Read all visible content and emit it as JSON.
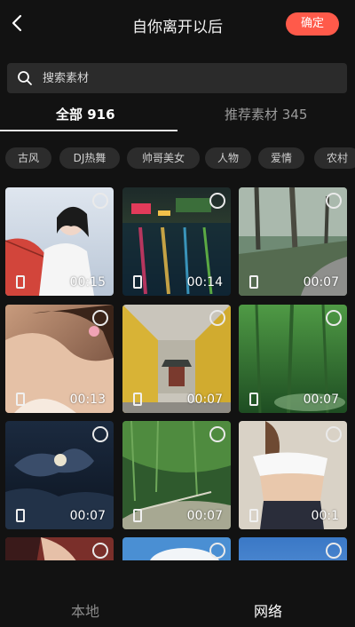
{
  "header": {
    "title": "自你离开以后",
    "confirm_label": "确定",
    "accent": "#ff5a4a"
  },
  "search": {
    "placeholder": "搜索素材"
  },
  "tabs": [
    {
      "label": "全部 916",
      "active": true
    },
    {
      "label": "推荐素材 345",
      "active": false
    }
  ],
  "chips": [
    "古风",
    "DJ热舞",
    "帅哥美女",
    "人物",
    "爱情",
    "农村"
  ],
  "videos": [
    {
      "duration": "00:15",
      "thumb": "woman-white-umbrella"
    },
    {
      "duration": "00:14",
      "thumb": "rainy-street-night"
    },
    {
      "duration": "00:07",
      "thumb": "foggy-park-path"
    },
    {
      "duration": "00:13",
      "thumb": "woman-flower"
    },
    {
      "duration": "00:07",
      "thumb": "temple-yellow-wall"
    },
    {
      "duration": "00:07",
      "thumb": "green-forest"
    },
    {
      "duration": "00:07",
      "thumb": "night-clouds"
    },
    {
      "duration": "00:07",
      "thumb": "bamboo-path"
    },
    {
      "duration": "00:1",
      "thumb": "woman-white-top"
    },
    {
      "duration": "",
      "thumb": "woman-red"
    },
    {
      "duration": "",
      "thumb": "blue-sky-clouds"
    },
    {
      "duration": "",
      "thumb": "blue-sky"
    }
  ],
  "bottom_tabs": [
    {
      "label": "本地",
      "active": false
    },
    {
      "label": "网络",
      "active": true
    }
  ]
}
